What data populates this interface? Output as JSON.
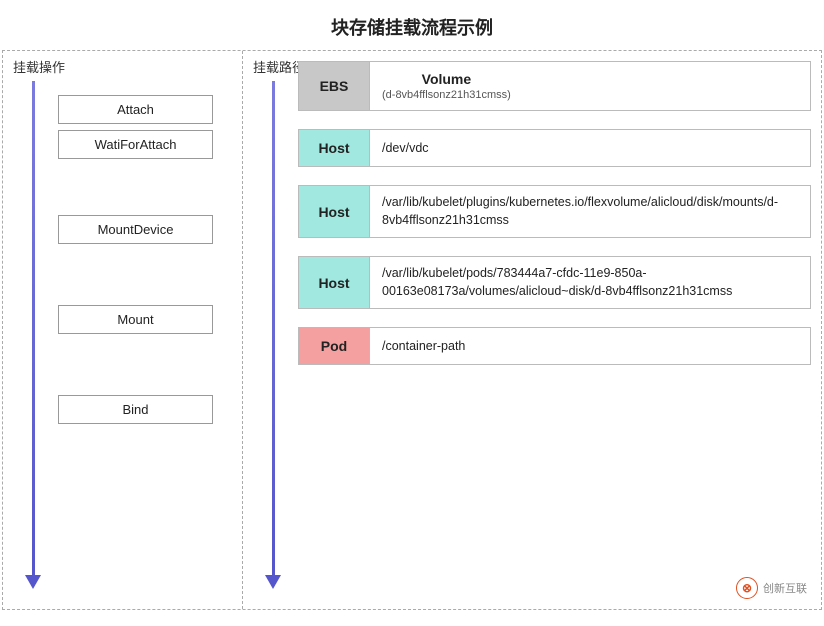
{
  "title": "块存储挂载流程示例",
  "left_header": "挂载操作",
  "right_header": "挂载路径",
  "operations": [
    {
      "label": "Attach"
    },
    {
      "label": "WatiForAttach"
    },
    {
      "label": "MountDevice"
    },
    {
      "label": "Mount"
    },
    {
      "label": "Bind"
    }
  ],
  "paths": [
    {
      "label_type": "ebs",
      "label_text": "EBS",
      "value_main": "Volume",
      "value_sub": "(d-8vb4fflsonz21h31cmss)",
      "is_volume": true
    },
    {
      "label_type": "host",
      "label_text": "Host",
      "value_main": "/dev/vdc",
      "is_volume": false
    },
    {
      "label_type": "host",
      "label_text": "Host",
      "value_main": "/var/lib/kubelet/plugins/kubernetes.io/flexvolume/alicloud/disk/mounts/d-8vb4fflsonz21h31cmss",
      "is_volume": false
    },
    {
      "label_type": "host",
      "label_text": "Host",
      "value_main": "/var/lib/kubelet/pods/783444a7-cfdc-11e9-850a-00163e08173a/volumes/alicloud~disk/d-8vb4fflsonz21h31cmss",
      "is_volume": false
    },
    {
      "label_type": "pod",
      "label_text": "Pod",
      "value_main": "/container-path",
      "is_volume": false
    }
  ],
  "watermark": {
    "icon": "⊗",
    "text": "创新互联"
  }
}
